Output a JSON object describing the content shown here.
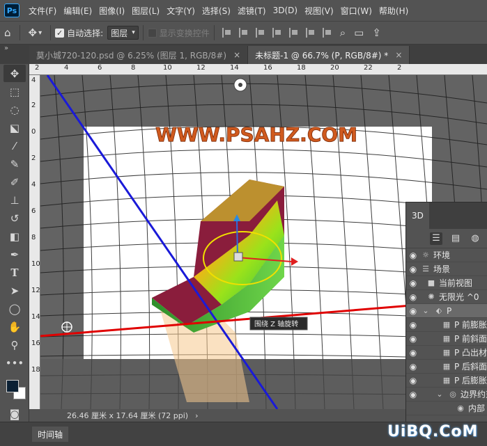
{
  "app": {
    "logo_text": "Ps"
  },
  "menu": [
    "文件(F)",
    "编辑(E)",
    "图像(I)",
    "图层(L)",
    "文字(Y)",
    "选择(S)",
    "滤镜(T)",
    "3D(D)",
    "视图(V)",
    "窗口(W)",
    "帮助(H)"
  ],
  "options": {
    "auto_select_label": "自动选择:",
    "auto_select_value": "图层",
    "show_transform_label": "显示变换控件"
  },
  "tabs": [
    {
      "label": "莫小城720-120.psd @ 6.25% (图层 1, RGB/8#)",
      "active": false
    },
    {
      "label": "未标题-1 @ 66.7% (P, RGB/8#) *",
      "active": true
    }
  ],
  "rulers": {
    "top": [
      "2",
      "4",
      "6",
      "8",
      "10",
      "12",
      "14",
      "16",
      "18",
      "20",
      "22",
      "2"
    ],
    "left": [
      "4",
      "2",
      "0",
      "2",
      "4",
      "6",
      "8",
      "10",
      "12",
      "14",
      "16",
      "18"
    ]
  },
  "canvas": {
    "watermark": "WWW.PSAHZ.COM",
    "tooltip": "围绕 Z 轴旋转"
  },
  "status": {
    "doc_size": "26.46 厘米 x 17.64 厘米 (72 ppi)"
  },
  "timeline": {
    "tab_label": "时间轴"
  },
  "panel3d": {
    "tab_label": "3D",
    "rows": [
      {
        "label": "环境",
        "icon": "environment-icon",
        "indent": 0
      },
      {
        "label": "场景",
        "icon": "scene-icon",
        "indent": 0
      },
      {
        "label": "当前视图",
        "icon": "camera-icon",
        "indent": 1
      },
      {
        "label": "无限光 ^0",
        "icon": "light-icon",
        "indent": 1
      },
      {
        "label": "P",
        "icon": "mesh-icon",
        "indent": 1,
        "selected": true
      },
      {
        "label": "P 前膨胀",
        "icon": "material-icon",
        "indent": 2
      },
      {
        "label": "P 前斜面",
        "icon": "material-icon",
        "indent": 2
      },
      {
        "label": "P 凸出材",
        "icon": "material-icon",
        "indent": 2
      },
      {
        "label": "P 后斜面",
        "icon": "material-icon",
        "indent": 2
      },
      {
        "label": "P 后膨胀",
        "icon": "material-icon",
        "indent": 2
      },
      {
        "label": "边界约束",
        "icon": "constraint-icon",
        "indent": 2
      },
      {
        "label": "内部",
        "icon": "inner-constraint-icon",
        "indent": 3
      }
    ]
  },
  "watermark_bottom": "UiBQ.CoM",
  "colors": {
    "foreground": "#0b2034",
    "background": "#ffffff",
    "accent": "#31a8ff",
    "axis_x": "#e00000",
    "axis_y": "#1a1ad8"
  }
}
